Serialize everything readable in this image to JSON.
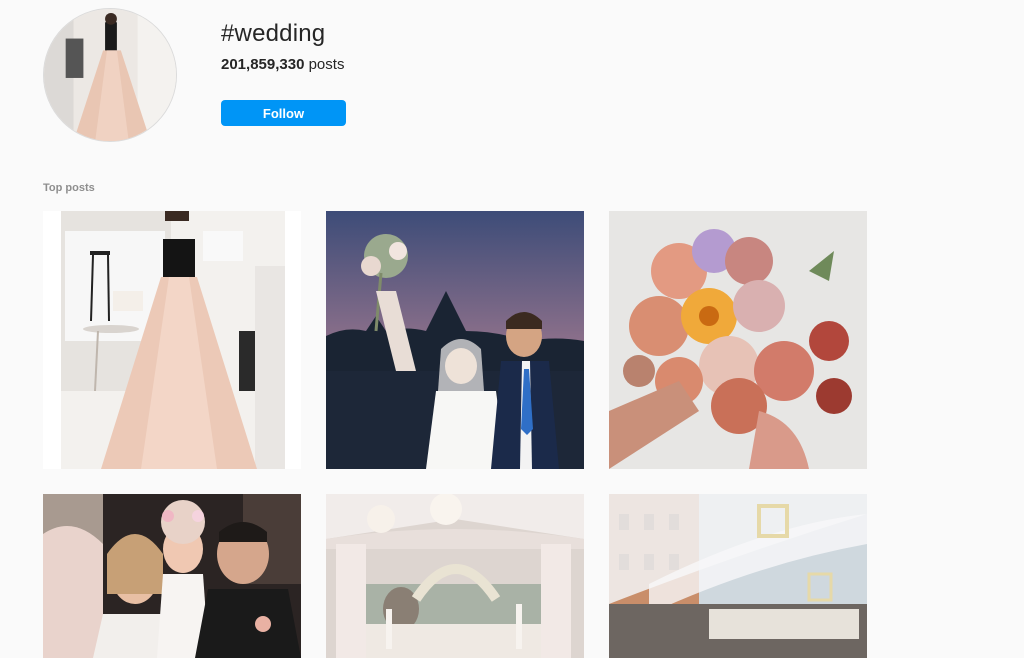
{
  "hashtag": {
    "title": "#wedding",
    "post_count": "201,859,330",
    "post_count_suffix": "posts"
  },
  "follow_button": {
    "label": "Follow"
  },
  "section": {
    "top_posts_label": "Top posts"
  },
  "colors": {
    "accent": "#0095f6",
    "background": "#fafafa",
    "muted_text": "#8e8e8e"
  },
  "posts": [
    {
      "description": "bridal gown photo"
    },
    {
      "description": "bride and groom at sunset"
    },
    {
      "description": "flower bouquet"
    },
    {
      "description": "family wedding photo"
    },
    {
      "description": "tent venue with chandeliers"
    },
    {
      "description": "outdoor tent venue"
    }
  ]
}
